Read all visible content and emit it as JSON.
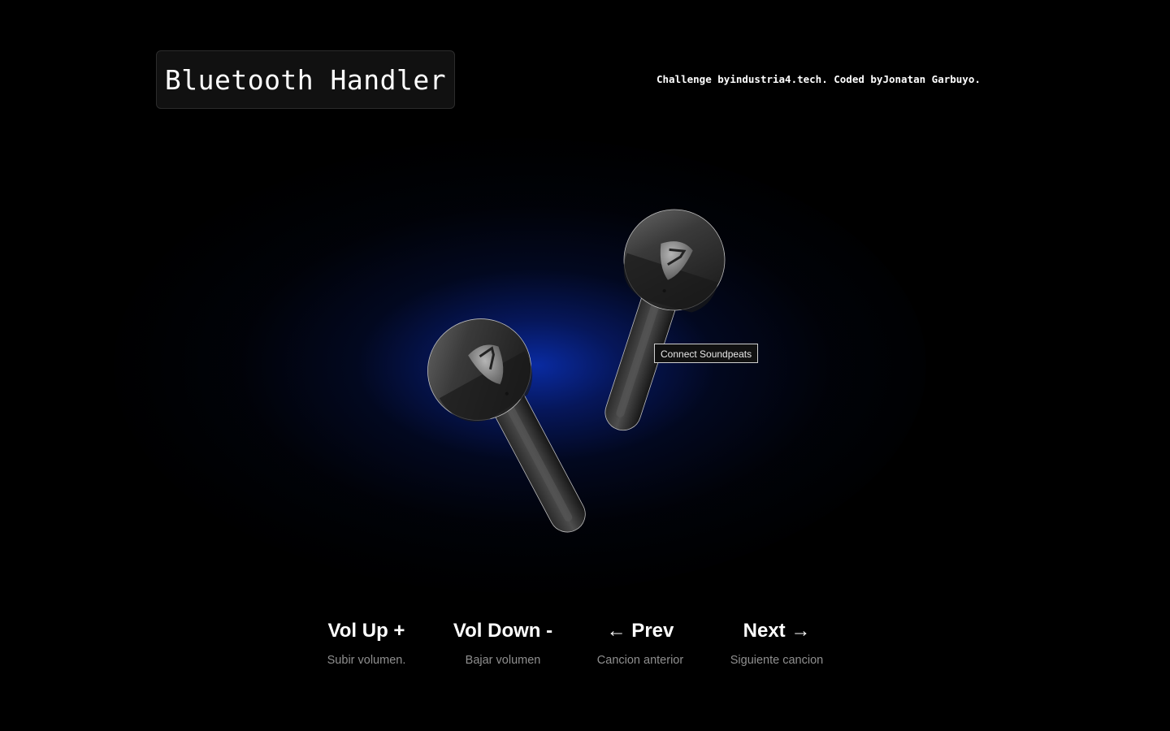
{
  "header": {
    "title": "Bluetooth Handler",
    "credits": {
      "prefix": "Challenge by",
      "challenge_link": "industria4.tech",
      "middle": ". Coded by",
      "author_link": "Jonatan Garbuyo",
      "suffix": "."
    }
  },
  "device": {
    "tooltip": "Connect Soundpeats",
    "glow_color": "#0a2daa"
  },
  "controls": [
    {
      "label": "Vol Up +",
      "description": "Subir volumen."
    },
    {
      "label": "Vol Down -",
      "description": "Bajar volumen"
    },
    {
      "label": "← Prev",
      "description": "Cancion anterior"
    },
    {
      "label": "Next →",
      "description": "Siguiente cancion"
    }
  ],
  "colors": {
    "background": "#000000",
    "text": "#ffffff",
    "muted_text": "#8f8f8f",
    "title_box_bg": "#111111"
  }
}
